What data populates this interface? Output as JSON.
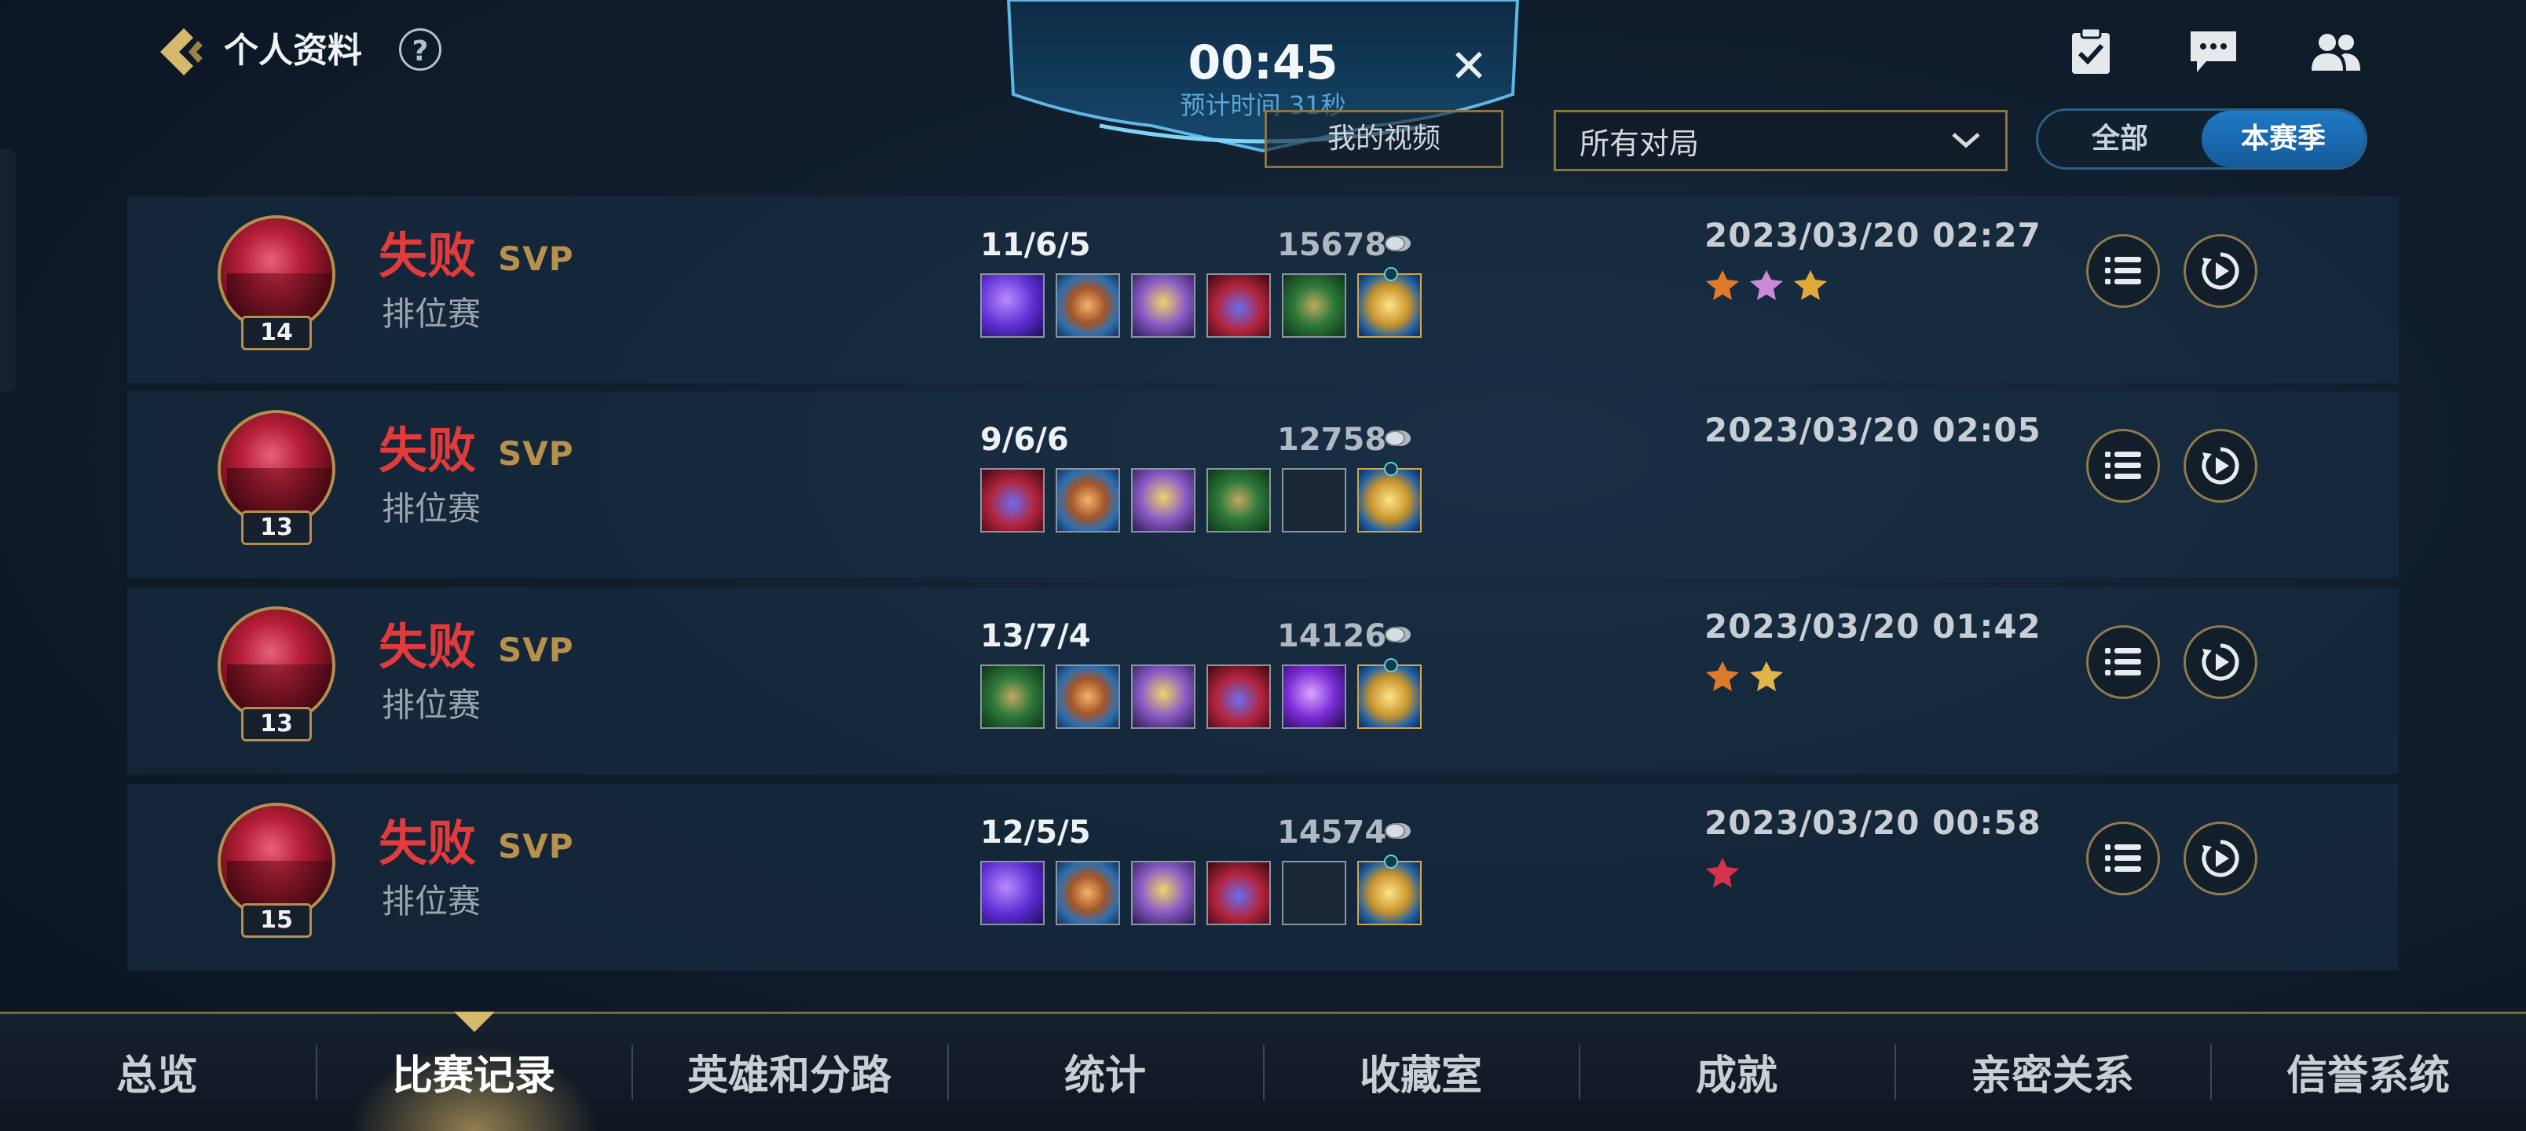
{
  "header": {
    "title": "个人资料",
    "help": "?"
  },
  "queue_timer": {
    "time": "00:45",
    "estimate": "预计时间 31秒",
    "close": "✕"
  },
  "filters": {
    "video_button": "我的视频",
    "match_type": "所有对局",
    "season_toggle": [
      "全部",
      "本赛季"
    ],
    "season_selected": "本赛季"
  },
  "matches": [
    {
      "result": "失败",
      "badge": "SVP",
      "mode": "排位赛",
      "level": "14",
      "kda": "11/6/5",
      "gold": "15678",
      "date": "2023/03/20 02:27",
      "items": [
        "purple",
        "orange",
        "purple-gold",
        "crimson",
        "green",
        "gold"
      ],
      "medals": [
        "orange-medal",
        "pink-medal",
        "gold-drop"
      ]
    },
    {
      "result": "失败",
      "badge": "SVP",
      "mode": "排位赛",
      "level": "13",
      "kda": "9/6/6",
      "gold": "12758",
      "date": "2023/03/20 02:05",
      "items": [
        "crimson",
        "orange",
        "purple-gold",
        "green",
        "empty",
        "gold"
      ],
      "medals": []
    },
    {
      "result": "失败",
      "badge": "SVP",
      "mode": "排位赛",
      "level": "13",
      "kda": "13/7/4",
      "gold": "14126",
      "date": "2023/03/20 01:42",
      "items": [
        "green",
        "orange",
        "purple-gold",
        "crimson",
        "violet",
        "gold"
      ],
      "medals": [
        "orange-medal",
        "gold-leaf"
      ]
    },
    {
      "result": "失败",
      "badge": "SVP",
      "mode": "排位赛",
      "level": "15",
      "kda": "12/5/5",
      "gold": "14574",
      "date": "2023/03/20 00:58",
      "items": [
        "purple",
        "orange",
        "purple-gold",
        "crimson",
        "empty",
        "gold"
      ],
      "medals": [
        "red-medal"
      ]
    }
  ],
  "nav": {
    "tabs": [
      "总览",
      "比赛记录",
      "英雄和分路",
      "统计",
      "收藏室",
      "成就",
      "亲密关系",
      "信誉系统"
    ],
    "active": "比赛记录"
  },
  "colors": {
    "loss": "#e23b3b",
    "svp": "#b7914c",
    "accent_blue": "#1f79c4",
    "gold_border": "#8a7440"
  },
  "icons": {
    "back": "chevron-left-icon",
    "tasks": "clipboard-check-icon",
    "chat": "chat-icon",
    "friends": "friends-icon",
    "detail": "list-icon",
    "replay": "replay-icon"
  }
}
